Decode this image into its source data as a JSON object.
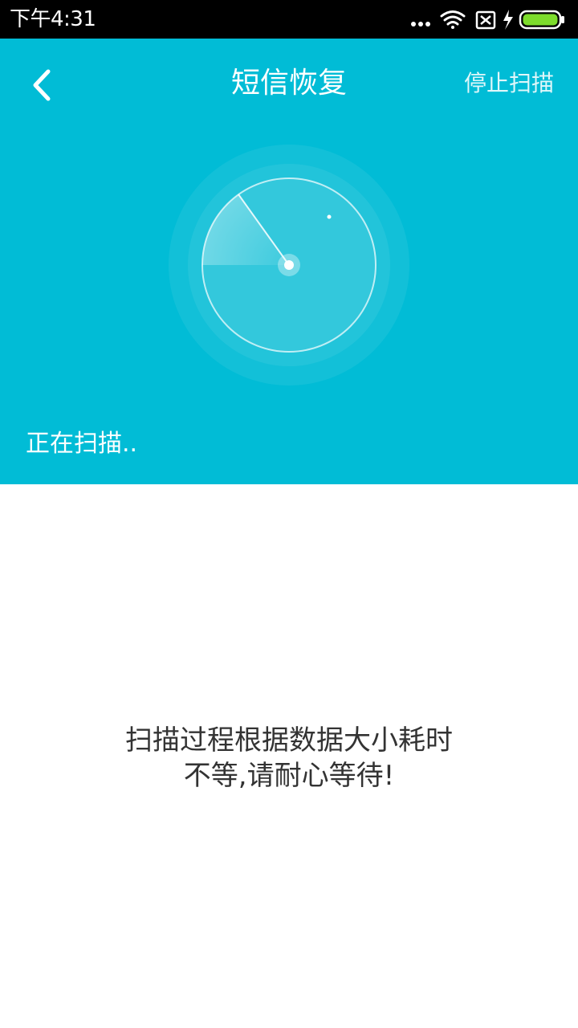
{
  "status_bar": {
    "time": "下午4:31",
    "icons": [
      "more-dots-icon",
      "wifi-icon",
      "no-sim-icon",
      "charging-icon",
      "battery-icon"
    ]
  },
  "header": {
    "title": "短信恢复",
    "stop_label": "停止扫描",
    "scanning_label": "正在扫描.."
  },
  "content": {
    "hint_line1": "扫描过程根据数据大小耗时",
    "hint_line2": "不等,请耐心等待!"
  },
  "colors": {
    "accent": "#01bcd6",
    "battery": "#7ddc2c"
  }
}
